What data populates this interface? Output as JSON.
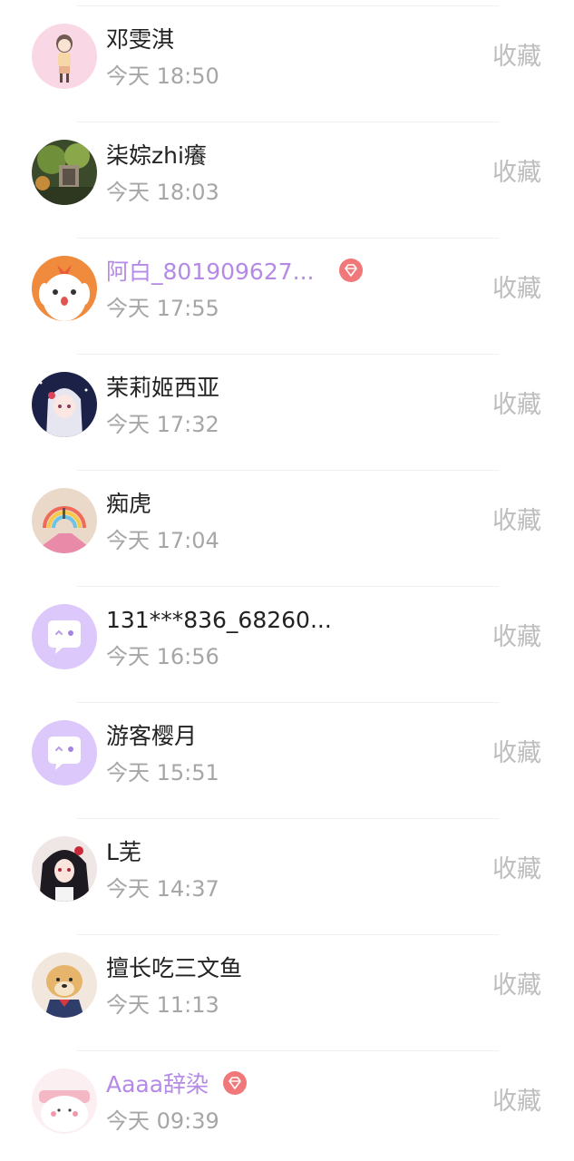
{
  "favorites_list": {
    "items": [
      {
        "name": "邓雯淇",
        "time": "今天 18:50",
        "action": "收藏",
        "vip": false,
        "avatar": "anime-girl-pink-avatar"
      },
      {
        "name": "柒婃zhi癢",
        "time": "今天 18:03",
        "action": "收藏",
        "vip": false,
        "avatar": "garden-photo-avatar"
      },
      {
        "name": "阿白_801909627...",
        "time": "今天 17:55",
        "action": "收藏",
        "vip": true,
        "avatar": "cartoon-dog-avatar"
      },
      {
        "name": "茉莉姬西亚",
        "time": "今天 17:32",
        "action": "收藏",
        "vip": false,
        "avatar": "anime-girl-night-avatar"
      },
      {
        "name": "痴虎",
        "time": "今天 17:04",
        "action": "收藏",
        "vip": false,
        "avatar": "rainbow-photo-avatar"
      },
      {
        "name": "131***836_68260...",
        "time": "今天 16:56",
        "action": "收藏",
        "vip": false,
        "avatar": "default-chat-bubble-avatar"
      },
      {
        "name": "游客樱月",
        "time": "今天 15:51",
        "action": "收藏",
        "vip": false,
        "avatar": "default-chat-bubble-avatar"
      },
      {
        "name": "L芜",
        "time": "今天 14:37",
        "action": "收藏",
        "vip": false,
        "avatar": "anime-girl-dark-hair-avatar"
      },
      {
        "name": "擅长吃三文鱼",
        "time": "今天 11:13",
        "action": "收藏",
        "vip": false,
        "avatar": "shiba-dog-avatar"
      },
      {
        "name": "Aaaa辞染",
        "time": "今天 09:39",
        "action": "收藏",
        "vip": true,
        "avatar": "pink-cat-cartoon-avatar"
      }
    ]
  },
  "colors": {
    "vip_name": "#b58ae6",
    "vip_gem": "#f07878",
    "name": "#222222",
    "time": "#a6a6a6",
    "action": "#bdbdbd",
    "default_avatar": "#dcc8fb"
  }
}
